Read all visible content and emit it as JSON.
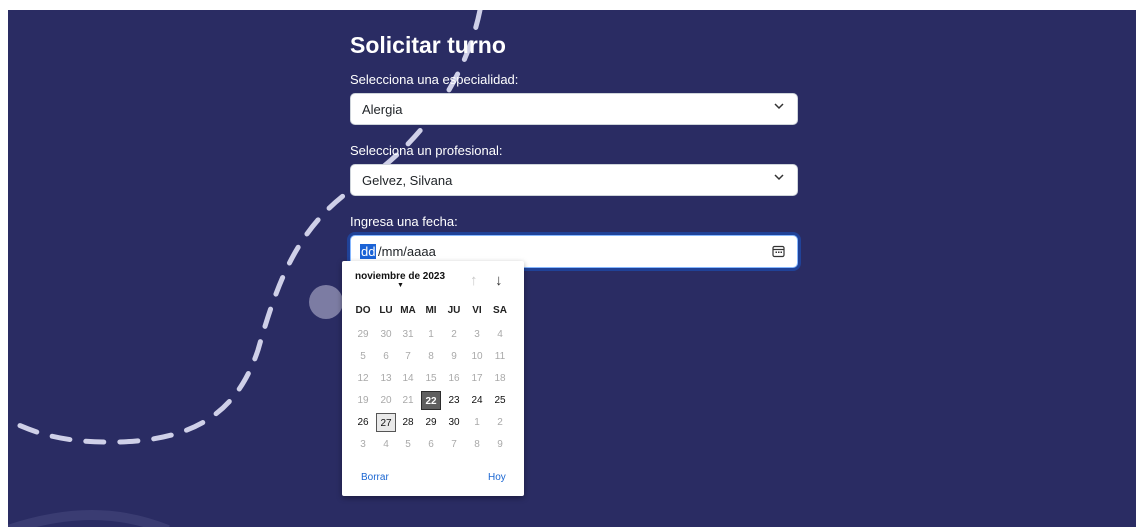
{
  "form": {
    "title": "Solicitar turno",
    "specialty_label": "Selecciona una especialidad:",
    "specialty_value": "Alergia",
    "professional_label": "Selecciona un profesional:",
    "professional_value": "Gelvez, Silvana",
    "date_label": "Ingresa una fecha:",
    "date_day_segment": "dd",
    "date_rest": "/mm/aaaa"
  },
  "datepicker": {
    "month_label": "noviembre de 2023",
    "weekdays": [
      "DO",
      "LU",
      "MA",
      "MI",
      "JU",
      "VI",
      "SA"
    ],
    "weeks": [
      [
        "29",
        "30",
        "31",
        "1",
        "2",
        "3",
        "4"
      ],
      [
        "5",
        "6",
        "7",
        "8",
        "9",
        "10",
        "11"
      ],
      [
        "12",
        "13",
        "14",
        "15",
        "16",
        "17",
        "18"
      ],
      [
        "19",
        "20",
        "21",
        "22",
        "23",
        "24",
        "25"
      ],
      [
        "26",
        "27",
        "28",
        "29",
        "30",
        "1",
        "2"
      ],
      [
        "3",
        "4",
        "5",
        "6",
        "7",
        "8",
        "9"
      ]
    ],
    "today": "22",
    "focused": "27",
    "clear_label": "Borrar",
    "today_label": "Hoy"
  },
  "colors": {
    "page_background": "#2a2c63",
    "accent": "#1a66d2"
  },
  "icons": [
    "chevron-down-icon",
    "calendar-icon",
    "arrow-up-icon",
    "arrow-down-icon",
    "caret-down-icon"
  ]
}
